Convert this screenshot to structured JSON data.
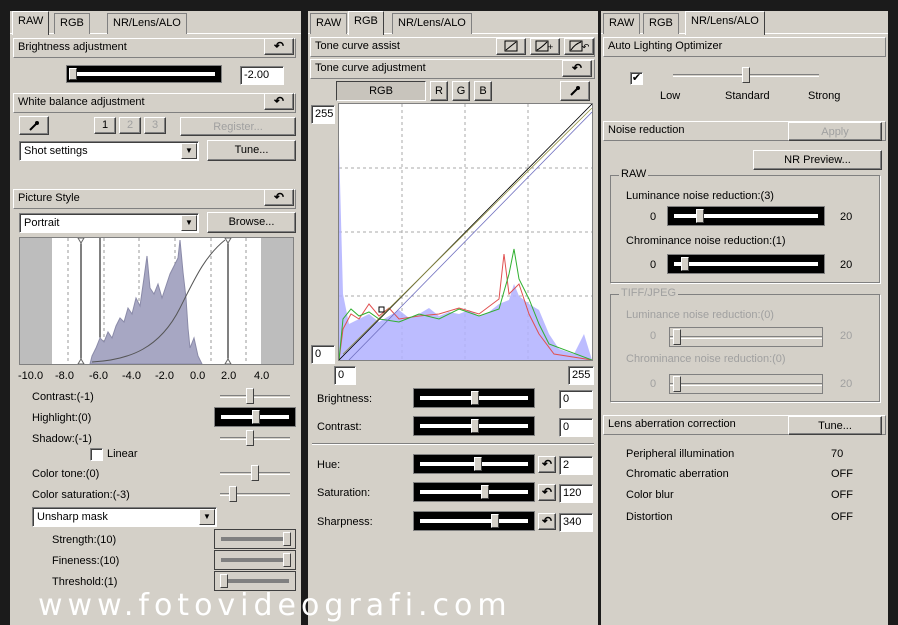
{
  "panel1": {
    "tabs": [
      "RAW",
      "RGB",
      "NR/Lens/ALO"
    ],
    "brightness": {
      "title": "Brightness adjustment",
      "value": "-2.00",
      "level": 0.03
    },
    "wb": {
      "title": "White balance adjustment",
      "nums": [
        "1",
        "2",
        "3"
      ],
      "register": "Register...",
      "mode": "Shot settings",
      "tune": "Tune..."
    },
    "picture_style": {
      "title": "Picture Style",
      "style": "Portrait",
      "browse": "Browse...",
      "axis": [
        "-10.0",
        "-8.0",
        "-6.0",
        "-4.0",
        "-2.0",
        "0.0",
        "2.0",
        "4.0"
      ],
      "contrast": "Contrast:(-1)",
      "highlight": "Highlight:(0)",
      "shadow": "Shadow:(-1)",
      "linear": "Linear",
      "color_tone": "Color tone:(0)",
      "color_sat": "Color saturation:(-3)",
      "sharp_mode": "Unsharp mask",
      "strength": "Strength:(10)",
      "fineness": "Fineness:(10)",
      "threshold": "Threshold:(1)"
    }
  },
  "panel2": {
    "tabs": [
      "RAW",
      "RGB",
      "NR/Lens/ALO"
    ],
    "tone_assist": "Tone curve assist",
    "tone_adj": "Tone curve adjustment",
    "channels": [
      "RGB",
      "R",
      "G",
      "B"
    ],
    "in_max": "255",
    "in_min": "0",
    "out_min": "0",
    "out_max": "255",
    "brightness": {
      "label": "Brightness:",
      "value": "0"
    },
    "contrast": {
      "label": "Contrast:",
      "value": "0"
    },
    "hue": {
      "label": "Hue:",
      "value": "2"
    },
    "saturation": {
      "label": "Saturation:",
      "value": "120"
    },
    "sharpness": {
      "label": "Sharpness:",
      "value": "340"
    }
  },
  "panel3": {
    "tabs": [
      "RAW",
      "RGB",
      "NR/Lens/ALO"
    ],
    "alo": {
      "title": "Auto Lighting Optimizer",
      "low": "Low",
      "standard": "Standard",
      "strong": "Strong"
    },
    "nr": {
      "title": "Noise reduction",
      "apply": "Apply",
      "preview": "NR Preview...",
      "raw_group": "RAW",
      "raw_lum": "Luminance noise reduction:(3)",
      "raw_chr": "Chrominance noise reduction:(1)",
      "tiff_group": "TIFF/JPEG",
      "tiff_lum": "Luminance noise reduction:(0)",
      "tiff_chr": "Chrominance noise reduction:(0)",
      "min": "0",
      "max": "20"
    },
    "lens": {
      "title": "Lens aberration correction",
      "tune": "Tune...",
      "items": [
        {
          "label": "Peripheral illumination",
          "value": "70"
        },
        {
          "label": "Chromatic aberration",
          "value": "OFF"
        },
        {
          "label": "Color blur",
          "value": "OFF"
        },
        {
          "label": "Distortion",
          "value": "OFF"
        }
      ]
    }
  },
  "watermark": "www.fotovideografi.com"
}
